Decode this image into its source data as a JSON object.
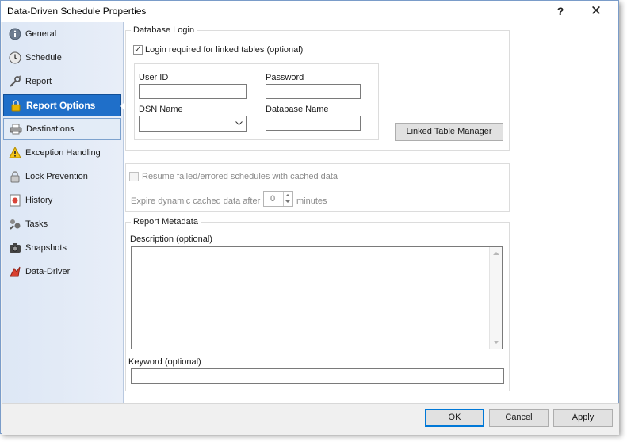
{
  "window": {
    "title": "Data-Driven Schedule Properties",
    "help_label": "?",
    "close_label": "✕"
  },
  "sidebar": {
    "items": [
      {
        "label": "General",
        "icon": "info-icon"
      },
      {
        "label": "Schedule",
        "icon": "clock-icon"
      },
      {
        "label": "Report",
        "icon": "wrench-icon"
      },
      {
        "label": "Report Options",
        "icon": "lock-icon",
        "active": true
      },
      {
        "label": "Destinations",
        "icon": "printer-icon"
      },
      {
        "label": "Exception Handling",
        "icon": "warning-icon"
      },
      {
        "label": "Lock Prevention",
        "icon": "padlock-icon"
      },
      {
        "label": "History",
        "icon": "history-icon"
      },
      {
        "label": "Tasks",
        "icon": "tasks-icon"
      },
      {
        "label": "Snapshots",
        "icon": "camera-icon"
      },
      {
        "label": "Data-Driver",
        "icon": "data-driver-icon"
      }
    ]
  },
  "database_login": {
    "group_title": "Database Login",
    "login_required_label": "Login required for linked tables (optional)",
    "login_required_checked": true,
    "user_id_label": "User ID",
    "user_id_value": "",
    "password_label": "Password",
    "password_value": "",
    "dsn_name_label": "DSN Name",
    "dsn_name_value": "",
    "database_name_label": "Database Name",
    "database_name_value": "",
    "linked_table_manager_label": "Linked Table Manager"
  },
  "cache": {
    "resume_label": "Resume failed/errored schedules with cached data",
    "resume_checked": false,
    "expire_label": "Expire dynamic cached data after",
    "expire_value": "0",
    "minutes_label": "minutes"
  },
  "metadata": {
    "group_title": "Report Metadata",
    "description_label": "Description (optional)",
    "description_value": "",
    "keyword_label": "Keyword (optional)",
    "keyword_value": ""
  },
  "footer": {
    "ok_label": "OK",
    "cancel_label": "Cancel",
    "apply_label": "Apply"
  },
  "colors": {
    "active_nav": "#1f6fc9",
    "sidebar_bg": "#dde7f5",
    "default_button_border": "#0078d7"
  }
}
